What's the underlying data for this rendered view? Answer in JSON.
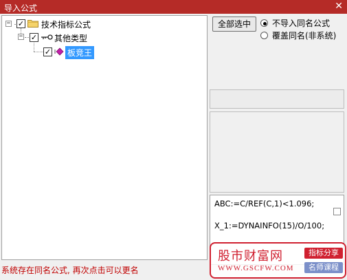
{
  "window": {
    "title": "导入公式",
    "close_glyph": "✕"
  },
  "tree": {
    "root": {
      "label": "技术指标公式",
      "checked": true,
      "toggle": "−"
    },
    "child": {
      "label": "其他类型",
      "checked": true,
      "toggle": "−"
    },
    "leaf": {
      "label": "板竞王",
      "checked": true,
      "selected": true
    }
  },
  "controls": {
    "select_all_label": "全部选中",
    "radio_options": [
      {
        "label": "不导入同名公式",
        "selected": true
      },
      {
        "label": "覆盖同名(非系统)",
        "selected": false
      }
    ]
  },
  "code": {
    "lines": [
      "ABC:=C/REF(C,1)<1.096;",
      "X_1:=DYNAINFO(15)/O/100;"
    ]
  },
  "status": {
    "message": "系统存在同名公式, 再次点击可以更名"
  },
  "watermark": {
    "brand": "股市财富网",
    "url": "WWW.GSCFW.COM",
    "tag1": "指标分享",
    "tag2": "名师课程"
  },
  "colors": {
    "titlebar": "#b52b27",
    "status_text": "#c00000",
    "selection": "#3399ff",
    "watermark_red": "#d02030"
  }
}
